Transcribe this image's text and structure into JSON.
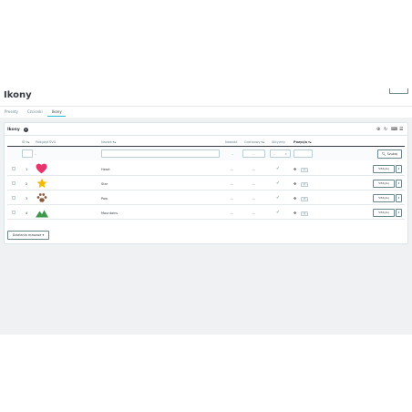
{
  "page": {
    "title": "Ikony"
  },
  "tabs": [
    {
      "label": "Presety",
      "active": false
    },
    {
      "label": "Czcionki",
      "active": false
    },
    {
      "label": "Ikony",
      "active": true
    }
  ],
  "panel": {
    "title": "Ikony",
    "count": "4",
    "tools": {
      "add": "⊕",
      "refresh": "↻",
      "sql": "⌨",
      "db": "☰"
    }
  },
  "table": {
    "columns": {
      "id": "ID ▾▴",
      "svg": "Podgląd SVG",
      "name": "Nazwa ▾▴",
      "new": "Nowość",
      "sale": "Gratisowy ▾▴",
      "active": "Aktywny",
      "position": "Pozycja ▾▴"
    },
    "filter": {
      "id_placeholder": "--",
      "new_value": "--",
      "sale_value": "--",
      "active_value": "--",
      "search_label": "Szukaj"
    },
    "rows": [
      {
        "id": "1",
        "icon": "heart-icon",
        "icon_color": "#e8336d",
        "name": "Heart",
        "new": "--",
        "sale": "--",
        "position": "1",
        "edit_label": "Edytuj"
      },
      {
        "id": "2",
        "icon": "star-icon",
        "icon_color": "#f5b800",
        "name": "Star",
        "new": "--",
        "sale": "--",
        "position": "2",
        "edit_label": "Edytuj"
      },
      {
        "id": "3",
        "icon": "paw-icon",
        "icon_color": "#8b5a3c",
        "name": "Paw",
        "new": "--",
        "sale": "--",
        "position": "3",
        "edit_label": "Edytuj"
      },
      {
        "id": "4",
        "icon": "mountains-icon",
        "icon_color": "#3c9a4a",
        "name": "Mountains",
        "new": "--",
        "sale": "--",
        "position": "4",
        "edit_label": "Edytuj"
      }
    ]
  },
  "bulk": {
    "label": "Działania masowe ▾"
  },
  "colors": {
    "accent": "#25b9d7",
    "success": "#70b580",
    "text": "#363a41",
    "muted": "#6c868e"
  }
}
